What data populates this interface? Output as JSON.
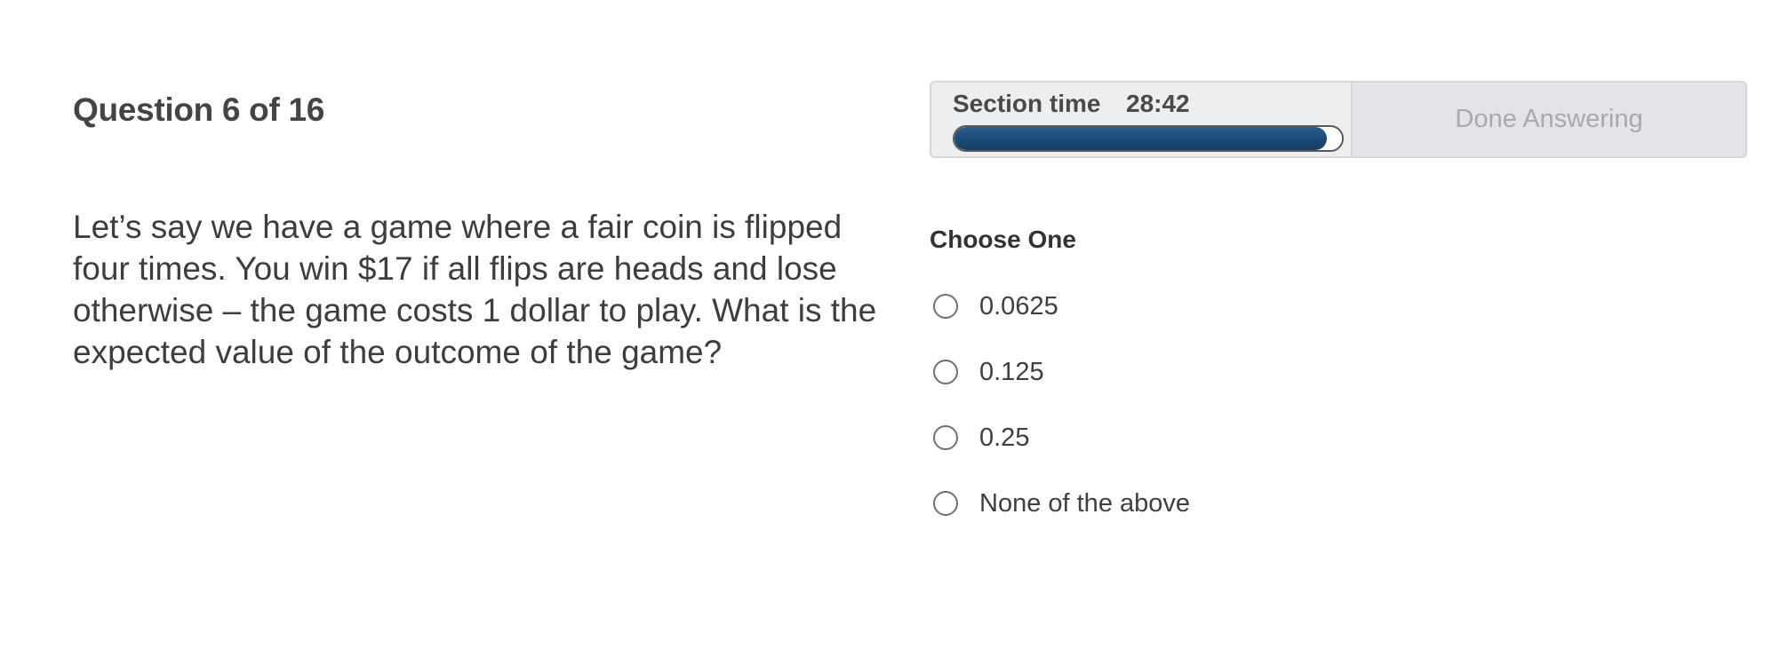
{
  "question": {
    "heading": "Question 6 of 16",
    "text": "Let’s say we have a game where a fair coin is flipped four times. You win $17 if all flips are heads and lose otherwise – the game costs 1 dollar to play. What is the expected value of the outcome of the game?"
  },
  "timer": {
    "label": "Section time",
    "value": "28:42",
    "progress_fraction": 0.96,
    "fill_color": "#1a4a77"
  },
  "done_button": {
    "label": "Done Answering",
    "disabled": true
  },
  "answers": {
    "prompt": "Choose One",
    "options": [
      {
        "label": "0.0625",
        "selected": false
      },
      {
        "label": "0.125",
        "selected": false
      },
      {
        "label": "0.25",
        "selected": false
      },
      {
        "label": "None of the above",
        "selected": false
      }
    ]
  }
}
